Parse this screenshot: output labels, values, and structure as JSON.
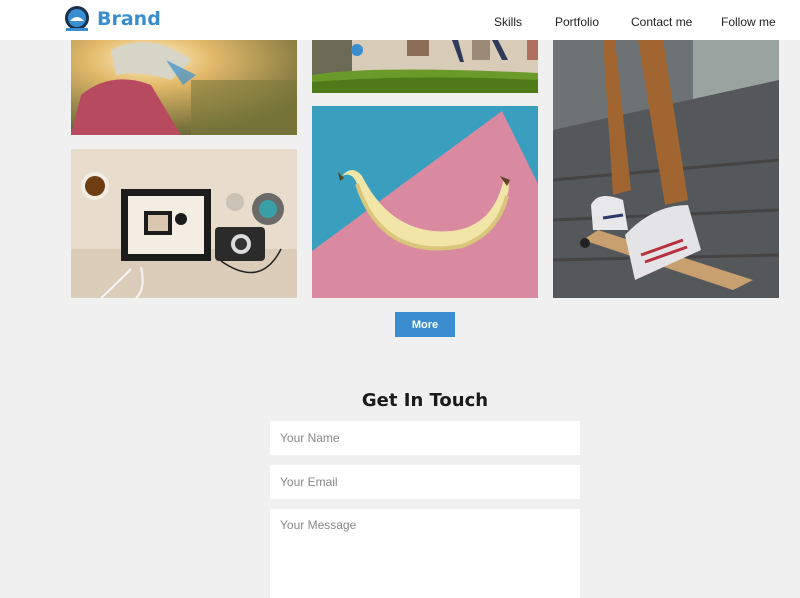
{
  "header": {
    "brand": "Brand",
    "nav": [
      "Skills",
      "Portfolio",
      "Contact me",
      "Follow me"
    ]
  },
  "gallery": {
    "photos": [
      {
        "subject": "child-with-cap"
      },
      {
        "subject": "legs-jumping-grass"
      },
      {
        "subject": "skateboard-sneakers"
      },
      {
        "subject": "desk-flatlay-camera"
      },
      {
        "subject": "banana-on-pink-blue"
      }
    ],
    "more_label": "More"
  },
  "contact": {
    "title": "Get In Touch",
    "name_placeholder": "Your Name",
    "email_placeholder": "Your Email",
    "message_placeholder": "Your Message"
  },
  "colors": {
    "accent": "#3a8ed0",
    "background": "#f0f0f0"
  }
}
